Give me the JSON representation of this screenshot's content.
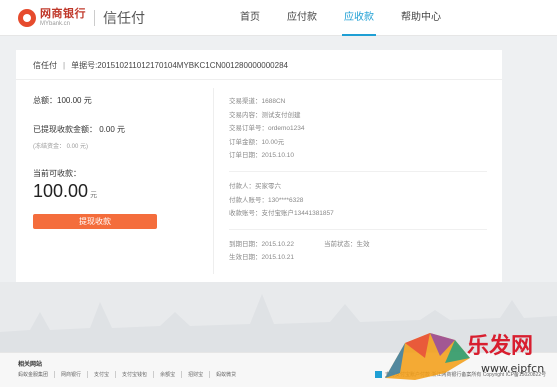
{
  "header": {
    "logo_name": "网商银行",
    "logo_sub": "MYbank.cn",
    "product": "信任付",
    "nav": [
      {
        "label": "首页"
      },
      {
        "label": "应付款"
      },
      {
        "label": "应收款"
      },
      {
        "label": "帮助中心"
      }
    ],
    "active_color": "#1f9fd4"
  },
  "card": {
    "head_product": "信任付",
    "head_sep": "|",
    "order_number": "单据号:20151021101217010​4MYBKC1CN001280000000284",
    "total": "总额：100.00  元",
    "refunded": "已提现收款金额：  0.00    元",
    "pending": "(冻结资金：  0.00   元)",
    "refundable_label": "当前可收款：",
    "refundable_amount": "100.00",
    "refundable_unit": "元",
    "refund_button": "提现收款",
    "accent_color": "#f46d3c",
    "details_a": [
      "交易渠道：1688CN",
      "交易内容：测试支付创建",
      "交易订单号：ordemo1234",
      "订单金额：10.00元",
      "订单日期：2015.10.10"
    ],
    "details_b": [
      "付款人：买家零六",
      "付款人账号：130****6328",
      "收款账号：支付宝账户13441381857"
    ],
    "due_date": "到期日期：2015.10.22",
    "status": "当前状态：生效",
    "effective_date": "生效日期：2015.10.21"
  },
  "footer": {
    "title": "相关网站",
    "links": [
      "蚂蚁金服集团",
      "网商银行",
      "支付宝",
      "支付宝钱包",
      "余额宝",
      "招财宝",
      "蚂蚁微贷"
    ],
    "right_text": "支持支付宝账户付款  浙江网商银行备案所有 Copyright  ICP备15020822号"
  },
  "watermark": {
    "text": "乐发网",
    "url": "www.eipfcn"
  }
}
